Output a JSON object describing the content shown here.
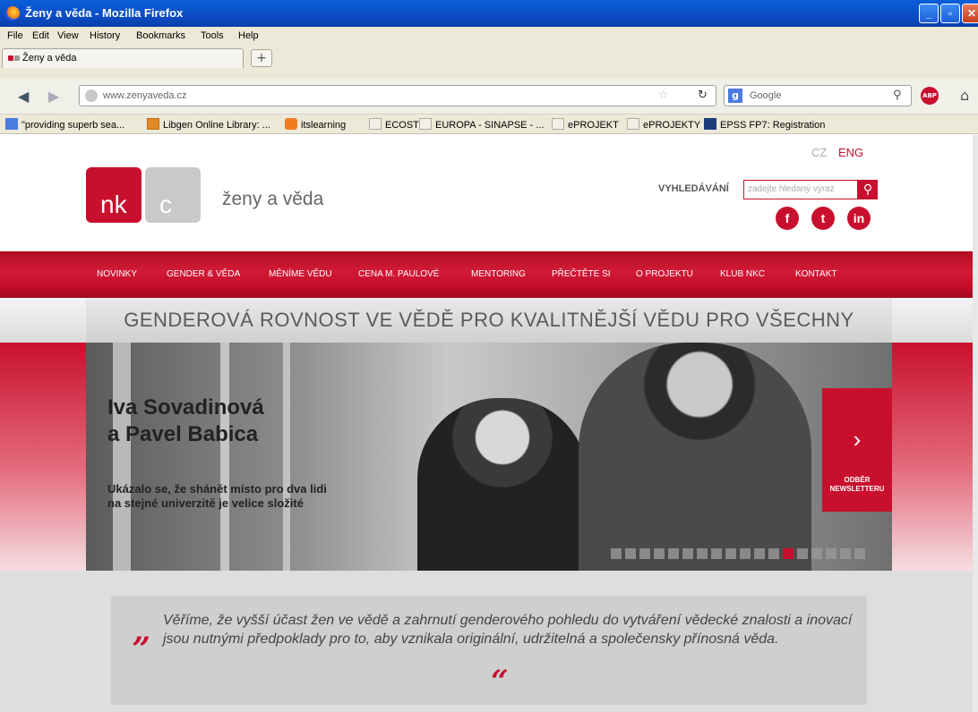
{
  "window": {
    "title": "Ženy a věda - Mozilla Firefox"
  },
  "menubar": [
    "File",
    "Edit",
    "View",
    "History",
    "Bookmarks",
    "Tools",
    "Help"
  ],
  "tab": {
    "label": "Ženy a věda",
    "new_tab": "+"
  },
  "nav": {
    "url": "www.zenyaveda.cz",
    "search_engine": "Google"
  },
  "bookmarks": [
    "\"providing superb sea...",
    "Libgen Online Library: ...",
    "itslearning",
    "ECOST",
    "EUROPA - SINAPSE - ...",
    "ePROJEKT",
    "ePROJEKTY",
    "EPSS FP7: Registration"
  ],
  "site": {
    "lang": {
      "cz": "CZ",
      "eng": "ENG"
    },
    "logo_nk": "nk",
    "logo_c": "c",
    "name": "ženy a věda",
    "search_label": "VYHLEDÁVÁNÍ",
    "search_placeholder": "zadejte hledaný výraz",
    "menu": [
      "NOVINKY",
      "GENDER & VĚDA",
      "MĚNÍME VĚDU",
      "CENA M. PAULOVÉ",
      "MENTORING",
      "PŘEČTĚTE SI",
      "O PROJEKTU",
      "KLUB NKC",
      "KONTAKT"
    ],
    "slogan": "GENDEROVÁ ROVNOST VE VĚDĚ PRO KVALITNĚJŠÍ VĚDU PRO VŠECHNY",
    "hero_name_1": "Iva Sovadinová",
    "hero_name_2": "a Pavel Babica",
    "hero_quote_1": "Ukázalo se, že shánět místo pro dva lidi",
    "hero_quote_2": "na stejné univerzitě je velice složité",
    "newsletter_1": "ODBĚR",
    "newsletter_2": "NEWSLETTERU",
    "quote_open": "„",
    "quote_close": "“",
    "quote": "Věříme, že vyšší účast žen ve vědě a zahrnutí genderového pohledu do vytváření vědecké znalosti a inovací jsou nutnými předpoklady pro to, aby vznikala originální, udržitelná a společensky přínosná věda."
  },
  "colors": {
    "brand_red": "#c8102e",
    "logo_grey": "#c9c9c9"
  }
}
